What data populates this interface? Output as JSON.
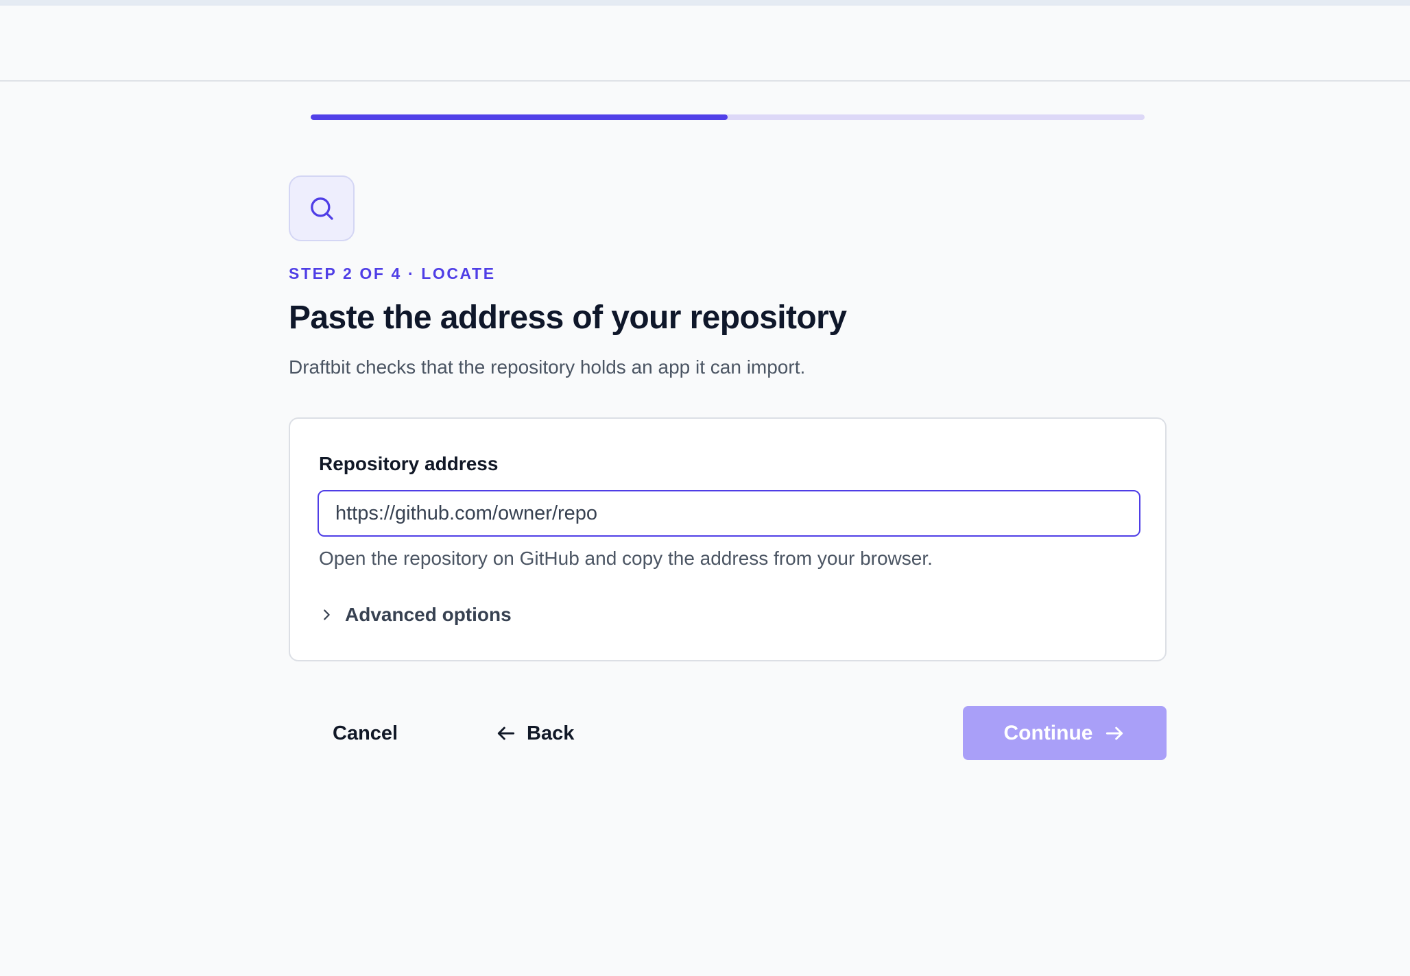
{
  "wizard": {
    "progress_fraction": 0.5,
    "eyebrow": "STEP 2 OF 4 · LOCATE",
    "title": "Paste the address of your repository",
    "subtitle": "Draftbit checks that the repository holds an app it can import.",
    "step_icon": "search-icon"
  },
  "form": {
    "field_label": "Repository address",
    "field_value": "https://github.com/owner/repo",
    "help_text": "Open the repository on GitHub and copy the address from your browser.",
    "advanced_label": "Advanced options",
    "advanced_icon": "chevron-right-icon"
  },
  "footer": {
    "cancel_label": "Cancel",
    "back_label": "Back",
    "back_icon": "arrow-left-icon",
    "continue_label": "Continue",
    "continue_icon": "arrow-right-icon"
  },
  "colors": {
    "accent": "#4f3ee6",
    "progress_track": "#ddd8f7",
    "continue_disabled": "#a99ff8"
  }
}
